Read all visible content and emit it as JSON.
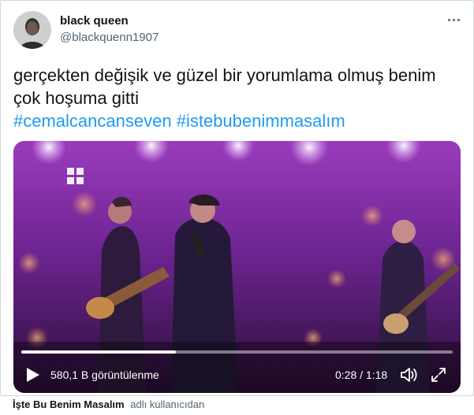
{
  "author": {
    "display_name": "black queen",
    "handle": "@blackquenn1907",
    "avatar_icon": "profile-photo"
  },
  "more_icon": "more-horizontal-icon",
  "tweet": {
    "line1": "gerçekten değişik ve güzel bir yorumlama olmuş benim",
    "line2": "çok hoşuma gitti",
    "hashtags": [
      "#cemalcancanseven",
      "#istebubenimmasalım"
    ]
  },
  "video": {
    "views": "580,1 B görüntülenme",
    "time": "0:28 / 1:18",
    "progress_fraction": 0.359,
    "icons": [
      "play-icon",
      "volume-icon",
      "fullscreen-icon"
    ]
  },
  "caption": {
    "source": "İşte Bu Benim Masalım",
    "suffix": "adlı kullanıcıdan"
  },
  "colors": {
    "link": "#1d9bf0",
    "secondary": "#536471",
    "border": "#cfd9de"
  }
}
